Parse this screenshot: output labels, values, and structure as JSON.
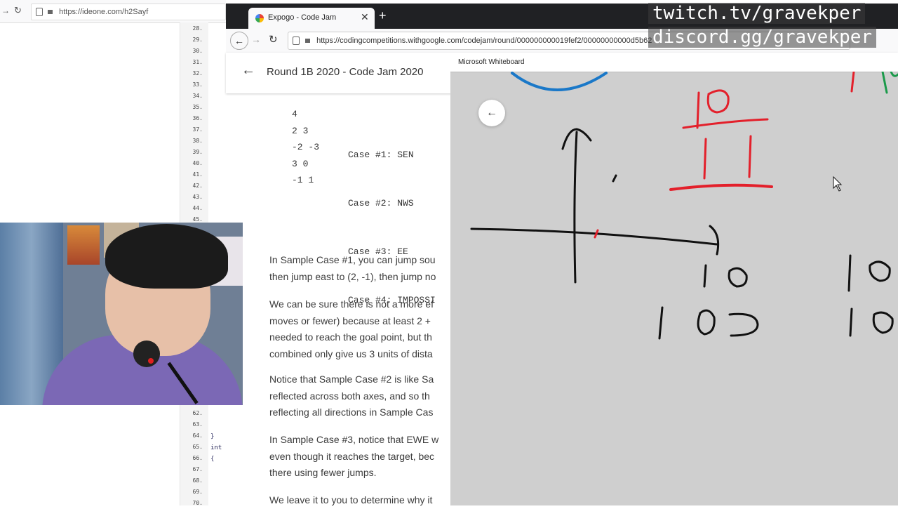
{
  "ideone": {
    "url": "https://ideone.com/h2Sayf",
    "line_numbers": [
      "28.",
      "29.",
      "30.",
      "31.",
      "32.",
      "33.",
      "34.",
      "35.",
      "36.",
      "37.",
      "38.",
      "39.",
      "40.",
      "41.",
      "42.",
      "43.",
      "44.",
      "45.",
      "62.",
      "63.",
      "64.",
      "65.",
      "66.",
      "67.",
      "68.",
      "69.",
      "70."
    ],
    "code_lines": [
      "}",
      "int",
      "{"
    ]
  },
  "browser": {
    "tab_title": "Expogo - Code Jam",
    "new_tab_label": "+",
    "url": "https://codingcompetitions.withgoogle.com/codejam/round/000000000019fef2/00000000000d5b62",
    "page_title": "Round 1B 2020 - Code Jam 2020",
    "sample_input": [
      "4",
      "2 3",
      "-2 -3",
      "3 0",
      "-1 1"
    ],
    "sample_output": [
      "Case #1: SEN",
      "Case #2: NWS",
      "Case #3: EE",
      "Case #4: IMPOSSI"
    ],
    "paragraphs": [
      [
        "In Sample Case #1, you can jump sou",
        "then jump east to (2, -1), then jump no"
      ],
      [
        "We can be sure there is not a more ef",
        "moves or fewer) because at least 2 +",
        "needed to reach the goal point, but th",
        "combined only give us 3 units of dista"
      ],
      [
        "Notice that Sample Case #2 is like Sa",
        "reflected across both axes, and so th",
        "reflecting all directions in Sample Cas"
      ],
      [
        "In Sample Case #3, notice that EWE w",
        "even though it reaches the target, bec",
        "there using fewer jumps."
      ],
      [
        "We leave it to you to determine why it"
      ]
    ]
  },
  "whiteboard": {
    "title": "Microsoft Whiteboard",
    "ink_black": "#111111",
    "ink_red": "#e3202b",
    "ink_blue": "#1a78c8",
    "ink_green": "#1b9a4a"
  },
  "overlay": {
    "twitch": "twitch.tv/gravekper",
    "discord": "discord.gg/gravekper"
  }
}
